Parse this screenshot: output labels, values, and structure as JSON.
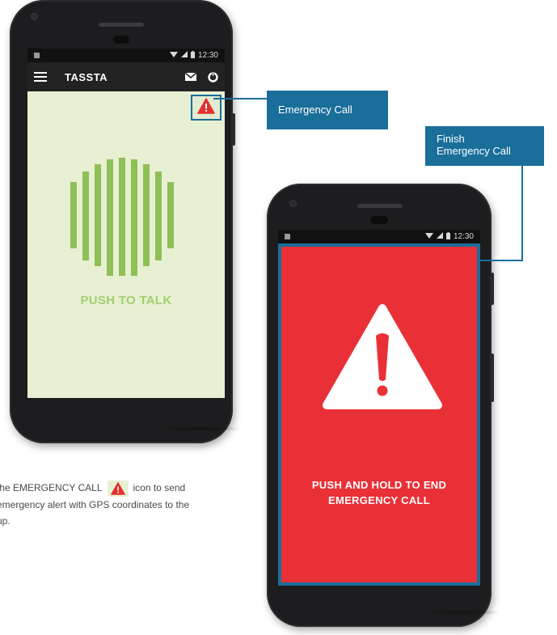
{
  "phone_left": {
    "status_time": "12:30",
    "app_title": "TASSTA",
    "ptt_label": "PUSH TO TALK",
    "icons": [
      "menu-icon",
      "mail-icon",
      "power-icon",
      "warning-icon",
      "ptt-bars-icon"
    ]
  },
  "phone_right": {
    "status_time": "12:30",
    "emergency_text_line1": "PUSH AND HOLD TO END",
    "emergency_text_line2": "EMERGENCY CALL",
    "icons": [
      "warning-icon"
    ]
  },
  "callouts": {
    "emergency_call": "Emergency Call",
    "finish_line1": "Finish",
    "finish_line2": "Emergency Call"
  },
  "description": {
    "part1": "the EMERGENCY CALL",
    "part2": "icon to send",
    "line2": "emergency alert with GPS coordinates to the",
    "line3": "up."
  },
  "colors": {
    "accent_blue": "#1a6e9a",
    "emergency_red": "#ea3037",
    "ptt_green": "#a3cf70",
    "ptt_background": "#e7f0d3"
  }
}
